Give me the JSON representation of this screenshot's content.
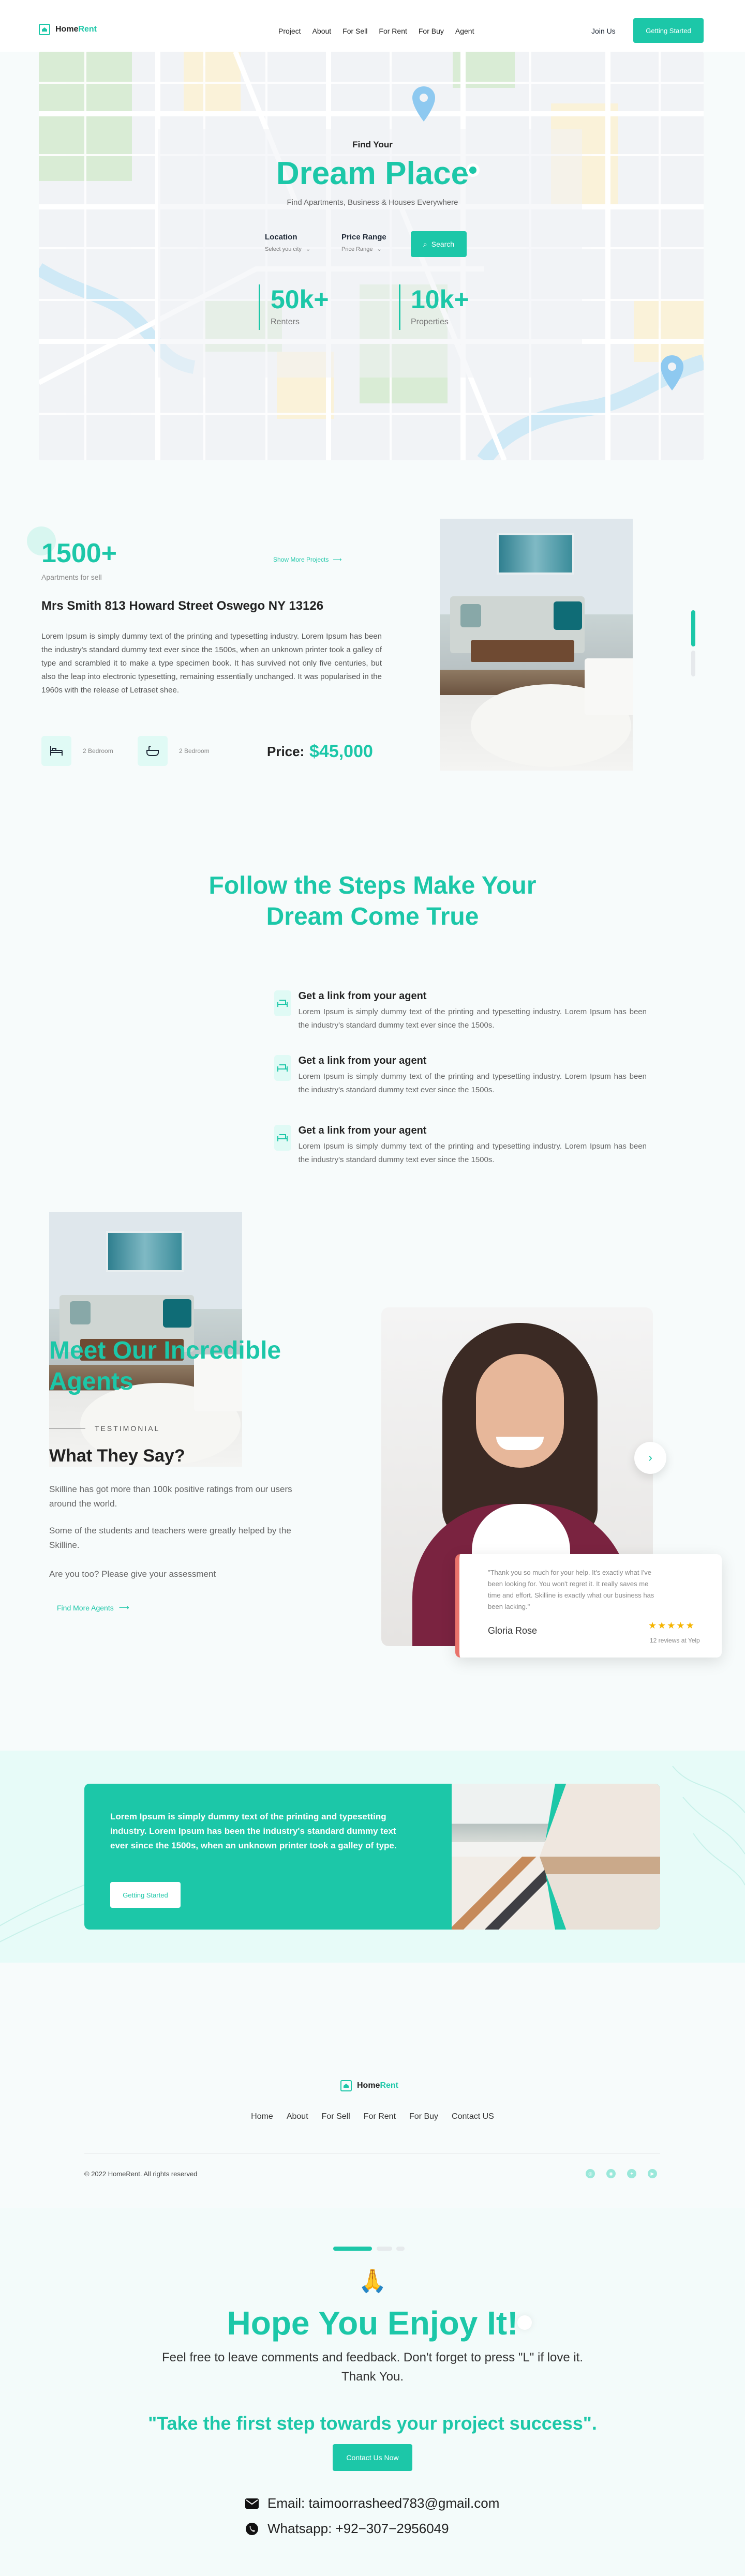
{
  "nav": {
    "logo_home": "Home",
    "logo_rent": "Rent",
    "links": [
      "Project",
      "About",
      "For Sell",
      "For Rent",
      "For Buy",
      "Agent"
    ],
    "join": "Join Us",
    "cta": "Getting Started"
  },
  "hero": {
    "kicker": "Find Your",
    "title": "Dream Place",
    "subtitle": "Find Apartments, Business & Houses Everywhere",
    "location_label": "Location",
    "location_value": "Select you city",
    "price_label": "Price Range",
    "price_value": "Price Range",
    "search": "Search",
    "stats": [
      {
        "value": "50k+",
        "label": "Renters"
      },
      {
        "value": "10k+",
        "label": "Properties"
      }
    ]
  },
  "property": {
    "count": "1500+",
    "count_label": "Apartments for sell",
    "show_more": "Show More Projects",
    "address": "Mrs Smith 813 Howard Street Oswego NY 13126",
    "description": "Lorem Ipsum is simply dummy text of the printing and typesetting industry. Lorem Ipsum has been the industry's standard dummy text ever since the 1500s, when an unknown printer took a galley of type and scrambled it to make a type specimen book. It has survived not only five centuries, but also the leap into electronic typesetting, remaining essentially unchanged. It was popularised in the 1960s with the release of Letraset shee.",
    "feature1": "2 Bedroom",
    "feature2": "2 Bedroom",
    "price_label": "Price:",
    "price_value": "$45,000"
  },
  "steps": {
    "title_line1": "Follow the Steps Make Your",
    "title_line2": "Dream Come True",
    "items": [
      {
        "title": "Get a link from your agent",
        "text": "Lorem Ipsum is simply dummy text of the printing and typesetting industry. Lorem Ipsum has been the industry's standard dummy text ever since the 1500s."
      },
      {
        "title": "Get a link from your agent",
        "text": "Lorem Ipsum is simply dummy text of the printing and typesetting industry. Lorem Ipsum has been the industry's standard dummy text ever since the 1500s."
      },
      {
        "title": "Get a link from your agent",
        "text": "Lorem Ipsum is simply dummy text of the printing and typesetting industry. Lorem Ipsum has been the industry's standard dummy text ever since the 1500s."
      }
    ]
  },
  "agents": {
    "title_line1": "Meet Our Incredible",
    "title_line2": "Agents",
    "kicker": "TESTIMONIAL",
    "heading": "What They Say?",
    "p1": "Skilline has got more than 100k positive ratings from our users around the world.",
    "p2": "Some of the students and teachers were greatly helped by the Skilline.",
    "p3": "Are you too? Please give your assessment",
    "link": "Find More Agents",
    "quote": "\"Thank you so much for your help. It's exactly what I've been looking for. You won't regret it. It really saves me time and effort. Skilline is exactly what our business has been lacking.\"",
    "name": "Gloria Rose",
    "rating": 5,
    "reviews": "12 reviews at Yelp"
  },
  "cta": {
    "text": "Lorem Ipsum is simply dummy text of the printing and typesetting industry. Lorem Ipsum has been the industry's standard dummy text ever since the 1500s, when an unknown printer took a galley of type.",
    "button": "Getting Started"
  },
  "footer": {
    "links": [
      "Home",
      "About",
      "For Sell",
      "For Rent",
      "For Buy",
      "Contact US"
    ],
    "copyright": "© 2022 HomeRent. All rights reserved"
  },
  "outro": {
    "emoji": "🙏",
    "title": "Hope You Enjoy It!",
    "line1": "Feel free to leave comments and feedback. Don't forget to press  \"L\" if love it.",
    "line2": "Thank You.",
    "quote": "\"Take the first step towards your project success\".",
    "button": "Contact Us Now",
    "email": "Email: taimoorrasheed783@gmail.com",
    "whatsapp": "Whatsapp: +92−307−2956049"
  },
  "colors": {
    "accent": "#1cc7a8",
    "coral": "#e9736b"
  }
}
